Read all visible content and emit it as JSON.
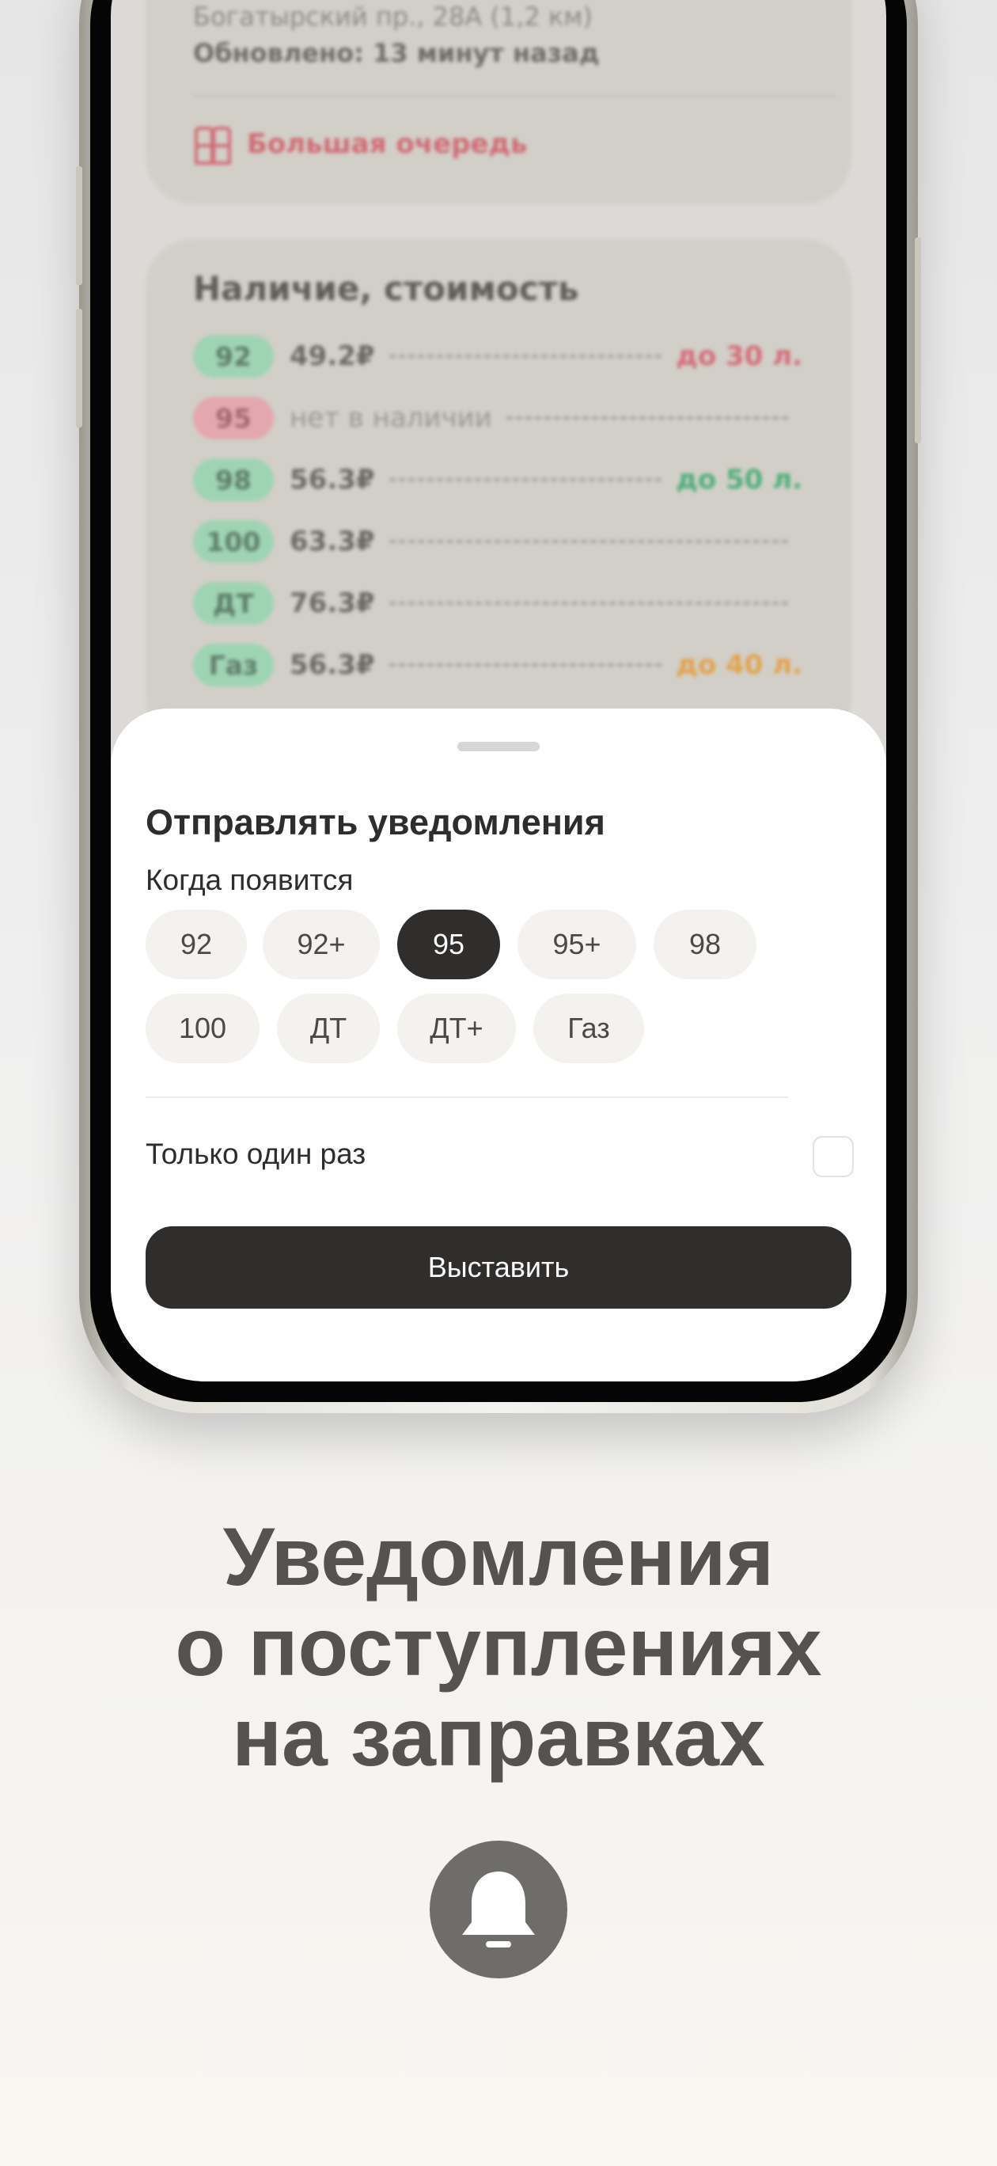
{
  "station": {
    "address": "Богатырский пр., 28А (1,2 км)",
    "updated": "Обновлено: 13 минут назад",
    "queue": "Большая очередь"
  },
  "availability": {
    "title": "Наличие, стоимость",
    "rows": [
      {
        "fuel": "92",
        "price": "49.2₽",
        "limit": "до 30 л.",
        "status": "available",
        "limit_color": "red"
      },
      {
        "fuel": "95",
        "price": "нет в наличии",
        "limit": "",
        "status": "unavailable",
        "limit_color": ""
      },
      {
        "fuel": "98",
        "price": "56.3₽",
        "limit": "до 50 л.",
        "status": "available",
        "limit_color": "green"
      },
      {
        "fuel": "100",
        "price": "63.3₽",
        "limit": "",
        "status": "available",
        "limit_color": ""
      },
      {
        "fuel": "ДТ",
        "price": "76.3₽",
        "limit": "",
        "status": "available",
        "limit_color": ""
      },
      {
        "fuel": "Газ",
        "price": "56.3₽",
        "limit": "до 40 л.",
        "status": "available",
        "limit_color": "orange"
      }
    ]
  },
  "sheet": {
    "title": "Отправлять уведомления",
    "subtitle": "Когда появится",
    "chips": [
      "92",
      "92+",
      "95",
      "95+",
      "98",
      "100",
      "ДТ",
      "ДТ+",
      "Газ"
    ],
    "selected_chip": "95",
    "once_label": "Только один раз",
    "once_checked": false,
    "submit_label": "Выставить"
  },
  "headline": {
    "lines": [
      "Уведомления",
      "о поступлениях",
      "на заправках"
    ]
  },
  "icons": {
    "bell": "bell-icon",
    "queue": "people-queue-icon"
  },
  "colors": {
    "accent_dark": "#2f2e2c",
    "available": "#9fd4b3",
    "unavailable": "#e3a8ae"
  }
}
